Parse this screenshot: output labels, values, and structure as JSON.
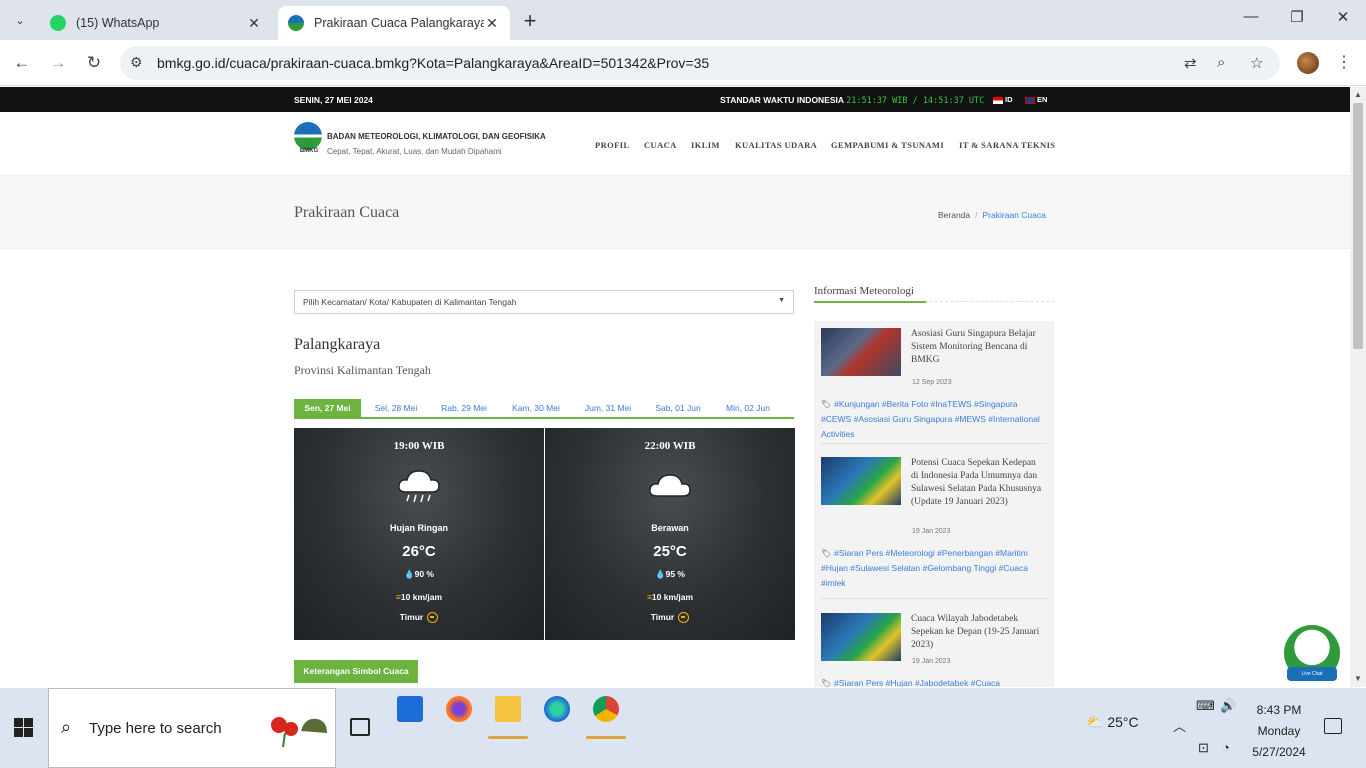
{
  "browser": {
    "tabs": [
      {
        "title": "(15) WhatsApp",
        "active": false
      },
      {
        "title": "Prakiraan Cuaca Palangkaraya - ",
        "active": true
      }
    ],
    "url": "bmkg.go.id/cuaca/prakiraan-cuaca.bmkg?Kota=Palangkaraya&AreaID=501342&Prov=35"
  },
  "topstrip": {
    "date": "SENIN, 27 MEI 2024",
    "clock_label": "STANDAR WAKTU INDONESIA",
    "clock_value": "21:51:37 WIB / 14:51:37 UTC",
    "lang_id": "ID",
    "lang_en": "EN"
  },
  "header": {
    "logo_text": "BMKG",
    "org_name": "BADAN METEOROLOGI, KLIMATOLOGI, DAN GEOFISIKA",
    "tagline": "Cepat, Tepat, Akurat, Luas, dan Mudah Dipahami",
    "menu": [
      "PROFIL",
      "CUACA",
      "IKLIM",
      "KUALITAS UDARA",
      "GEMPABUMI & TSUNAMI",
      "IT & SARANA TEKNIS"
    ]
  },
  "titlebar": {
    "title": "Prakiraan Cuaca",
    "breadcrumb_home": "Beranda",
    "breadcrumb_sep": "/",
    "breadcrumb_current": "Prakiraan Cuaca"
  },
  "forecast": {
    "select_placeholder": "Pilih Kecamatan/ Kota/ Kabupaten di Kalimantan Tengah",
    "city": "Palangkaraya",
    "province": "Provinsi Kalimantan Tengah",
    "days": [
      "Sen, 27 Mei",
      "Sel, 28 Mei",
      "Rab, 29 Mei",
      "Kam, 30 Mei",
      "Jum, 31 Mei",
      "Sab, 01 Jun",
      "Min, 02 Jun"
    ],
    "cards": [
      {
        "time": "19:00 WIB",
        "icon": "rain-cloud-icon",
        "condition": "Hujan Ringan",
        "temp": "26°C",
        "humidity": "90 %",
        "wind": "10 km/jam",
        "direction": "Timur"
      },
      {
        "time": "22:00 WIB",
        "icon": "cloud-icon",
        "condition": "Berawan",
        "temp": "25°C",
        "humidity": "95 %",
        "wind": "10 km/jam",
        "direction": "Timur"
      }
    ],
    "legend_button": "Keterangan Simbol Cuaca"
  },
  "sidebar": {
    "title": "Informasi Meteorologi",
    "news": [
      {
        "headline": "Asosiasi Guru Singapura Belajar Sistem Monitoring Bencana di BMKG",
        "date": "12 Sep 2023",
        "tags": "#Kunjungan #Berita Foto #InaTEWS #Singapura #CEWS #Asosiasi Guru Singapura #MEWS #International Activities"
      },
      {
        "headline": "Potensi Cuaca Sepekan Kedepan di Indonesia Pada Umumnya dan Sulawesi Selatan Pada Khususnya (Update 19 Januari 2023)",
        "date": "19 Jan 2023",
        "tags": "#Siaran Pers #Meteorologi #Penerbangan #Maritim #Hujan #Sulawesi Selatan #Gelombang Tinggi #Cuaca #imlek"
      },
      {
        "headline": "Cuaca Wilayah Jabodetabek Sepekan ke Depan (19-25 Januari 2023)",
        "date": "19 Jan 2023",
        "tags": "#Siaran Pers #Hujan #Jabodetabek #Cuaca"
      }
    ]
  },
  "livechat": {
    "label": "Live Chat"
  },
  "taskbar": {
    "search_placeholder": "Type here to search",
    "weather_temp": "25°C",
    "time": "8:43 PM",
    "day": "Monday",
    "date": "5/27/2024"
  }
}
